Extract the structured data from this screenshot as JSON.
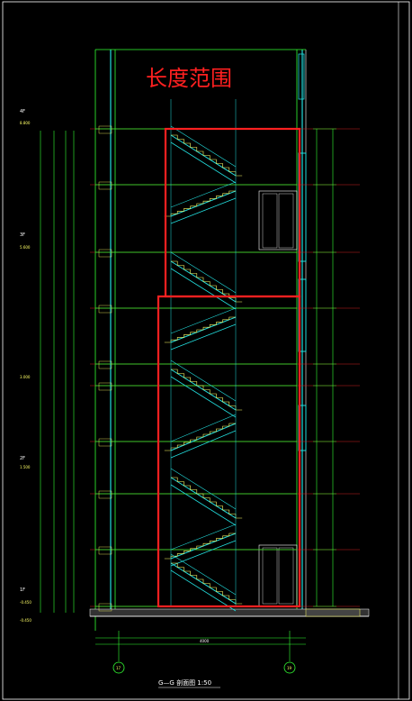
{
  "annotation": {
    "title": "长度范围"
  },
  "caption": {
    "text": "G—G 剖面图 1:50"
  },
  "axis_markers": [
    {
      "label": "17"
    },
    {
      "label": "19"
    }
  ],
  "floor_labels": [
    {
      "label": "4F"
    },
    {
      "label": "3F"
    },
    {
      "label": "2F"
    },
    {
      "label": "1F"
    }
  ],
  "elevations": [
    "8.800",
    "5.600",
    "3.000",
    "1.500",
    "-0.450",
    "-0.450"
  ],
  "bottom_dimension": "4000",
  "colors": {
    "background": "#000000",
    "grid_green": "#33ff33",
    "stair_cyan": "#22dddd",
    "highlight_red": "#ff2020",
    "hatch_yellow": "#ffff66",
    "floor_red": "#cc2222"
  }
}
